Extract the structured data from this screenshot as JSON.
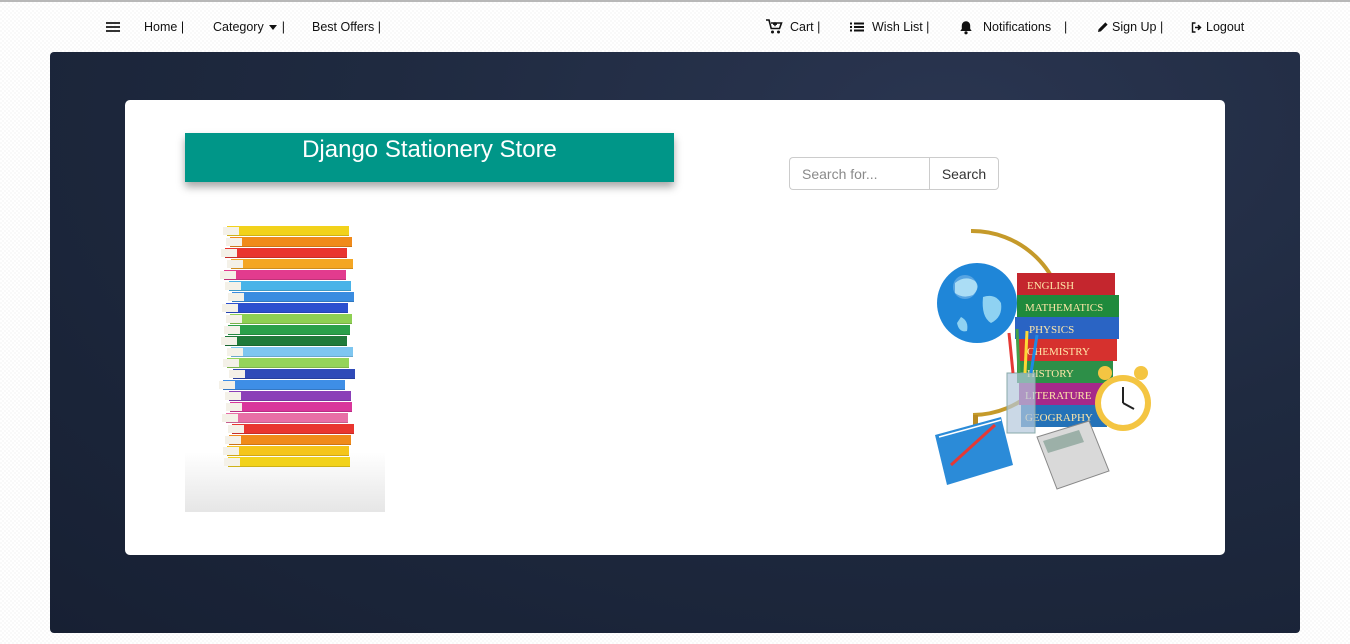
{
  "nav": {
    "menu_icon": "hamburger-menu-icon",
    "home": "Home |",
    "category": "Category",
    "category_sep": "|",
    "best_offers": "Best Offers |",
    "cart": "Cart |",
    "cart_icon": "shopping-cart-icon",
    "wishlist": "Wish List |",
    "wishlist_icon": "list-icon",
    "notifications": "Notifications",
    "notifications_sep": "|",
    "notifications_icon": "bell-icon",
    "signup": "Sign Up |",
    "signup_icon": "pencil-icon",
    "logout": "Logout",
    "logout_icon": "logout-icon"
  },
  "hero": {
    "title": "Django Stationery Store",
    "search_placeholder": "Search for...",
    "search_button": "Search"
  },
  "colors": {
    "brand_teal": "#009688",
    "hero_dark": "#1f2a40"
  }
}
